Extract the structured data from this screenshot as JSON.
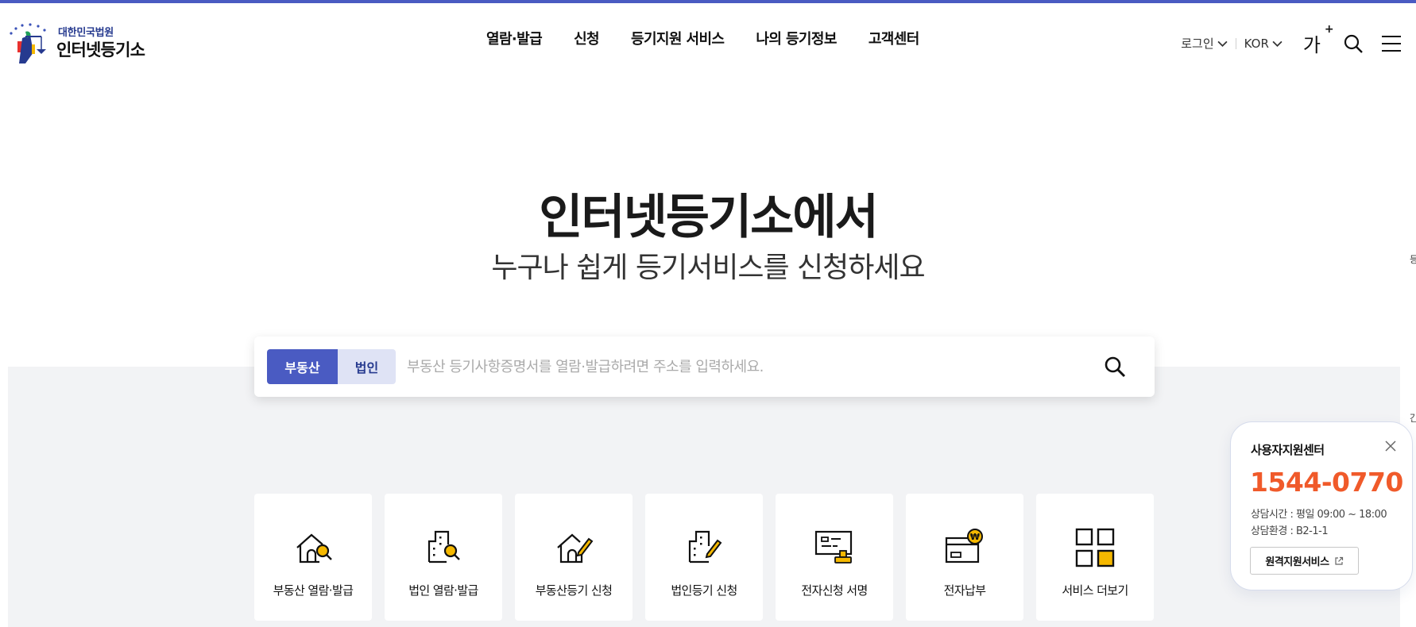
{
  "header": {
    "org_name": "대한민국법원",
    "site_name": "인터넷등기소",
    "nav": [
      "열람·발급",
      "신청",
      "등기지원 서비스",
      "나의 등기정보",
      "고객센터"
    ],
    "login_label": "로그인",
    "lang_label": "KOR",
    "font_size_label": "가",
    "font_size_sup": "+"
  },
  "hero": {
    "title": "인터넷등기소에서",
    "subtitle": "누구나 쉽게 등기서비스를 신청하세요"
  },
  "search": {
    "tabs": [
      "부동산",
      "법인"
    ],
    "active_tab": "부동산",
    "placeholder": "부동산 등기사항증명서를 열람·발급하려면 주소를 입력하세요.",
    "value": ""
  },
  "services": [
    {
      "label": "부동산 열람·발급",
      "icon": "house-search-icon"
    },
    {
      "label": "법인 열람·발급",
      "icon": "building-search-icon"
    },
    {
      "label": "부동산등기 신청",
      "icon": "house-pen-icon"
    },
    {
      "label": "법인등기 신청",
      "icon": "building-pen-icon"
    },
    {
      "label": "전자신청 서명",
      "icon": "document-stamp-icon"
    },
    {
      "label": "전자납부",
      "icon": "card-won-icon"
    },
    {
      "label": "서비스 더보기",
      "icon": "grid-icon"
    }
  ],
  "support": {
    "title": "사용자지원센터",
    "phone": "1544-0770",
    "hours": "상담시간 : 평일 09:00 ~ 18:00",
    "env": "상담환경 : B2-1-1",
    "remote_label": "원격지원서비스"
  },
  "edge_letters": [
    "등",
    "간"
  ],
  "colors": {
    "accent": "#4a5bc2",
    "tab_inactive": "#dfe3f5",
    "phone": "#f05a2a",
    "icon_yellow": "#f5b800",
    "gray_bg": "#f2f3f5"
  }
}
